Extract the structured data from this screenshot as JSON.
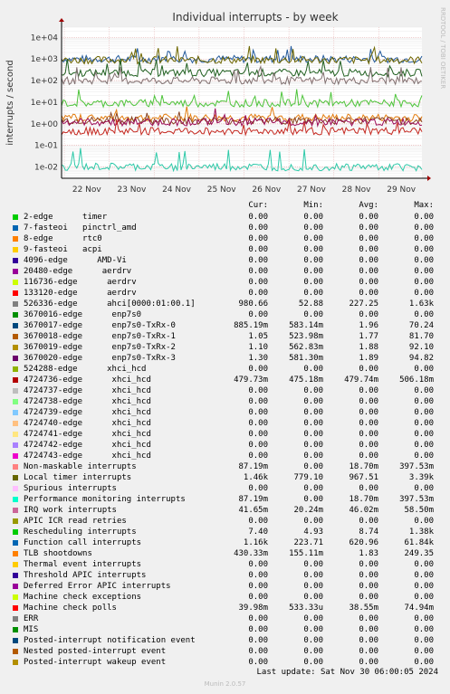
{
  "chart_data": {
    "type": "line",
    "title": "Individual interrupts - by week",
    "ylabel": "interrupts / second",
    "yscale": "log",
    "ylim": [
      0.003,
      30000
    ],
    "y_ticks": [
      {
        "value": 0.01,
        "label": "1e-02"
      },
      {
        "value": 0.1,
        "label": "1e-01"
      },
      {
        "value": 1,
        "label": "1e+00"
      },
      {
        "value": 10,
        "label": "1e+01"
      },
      {
        "value": 100,
        "label": "1e+02"
      },
      {
        "value": 1000,
        "label": "1e+03"
      },
      {
        "value": 10000,
        "label": "1e+04"
      }
    ],
    "x_ticks": [
      "22 Nov",
      "23 Nov",
      "24 Nov",
      "25 Nov",
      "26 Nov",
      "27 Nov",
      "28 Nov",
      "29 Nov"
    ],
    "watermark": "RRDTOOL / TOBI OETIKER",
    "grid": true,
    "series": [
      {
        "name": "Function call interrupts",
        "color": "#235A9C",
        "level": 1000
      },
      {
        "name": "Local timer interrupts",
        "color": "#6F6700",
        "level": 900
      },
      {
        "name": "526336-edge ahci[0000:01:00.1]",
        "color": "#206020",
        "level": 230
      },
      {
        "name": "Non-maskable interrupts",
        "color": "#807070",
        "level": 100
      },
      {
        "name": "Rescheduling interrupts",
        "color": "#4EC43B",
        "level": 9
      },
      {
        "name": "3670017-edge enp7s0-TxRx-0",
        "color": "#E37C0D",
        "level": 1.9
      },
      {
        "name": "3670019-edge enp7s0-TxRx-2",
        "color": "#884422",
        "level": 1.4
      },
      {
        "name": "Performance monitoring interrupts",
        "color": "#9A0C58",
        "level": 1.2
      },
      {
        "name": "4724736-edge xhci_hcd",
        "color": "#C52820",
        "level": 0.45
      },
      {
        "name": "TLB shootdowns",
        "color": "#2DC9A8",
        "level": 0.01
      }
    ]
  },
  "legend": {
    "headers": [
      "Cur:",
      "Min:",
      "Avg:",
      "Max:"
    ],
    "rows": [
      {
        "label": "2-edge      timer",
        "color": "#00CC00",
        "cur": "0.00",
        "min": "0.00",
        "avg": "0.00",
        "max": "0.00"
      },
      {
        "label": "7-fasteoi   pinctrl_amd",
        "color": "#0066B3",
        "cur": "0.00",
        "min": "0.00",
        "avg": "0.00",
        "max": "0.00"
      },
      {
        "label": "8-edge      rtc0",
        "color": "#FF8000",
        "cur": "0.00",
        "min": "0.00",
        "avg": "0.00",
        "max": "0.00"
      },
      {
        "label": "9-fasteoi   acpi",
        "color": "#FFCC00",
        "cur": "0.00",
        "min": "0.00",
        "avg": "0.00",
        "max": "0.00"
      },
      {
        "label": "4096-edge      AMD-Vi",
        "color": "#330099",
        "cur": "0.00",
        "min": "0.00",
        "avg": "0.00",
        "max": "0.00"
      },
      {
        "label": "20480-edge      aerdrv",
        "color": "#990099",
        "cur": "0.00",
        "min": "0.00",
        "avg": "0.00",
        "max": "0.00"
      },
      {
        "label": "116736-edge      aerdrv",
        "color": "#CCFF00",
        "cur": "0.00",
        "min": "0.00",
        "avg": "0.00",
        "max": "0.00"
      },
      {
        "label": "133120-edge      aerdrv",
        "color": "#FF0000",
        "cur": "0.00",
        "min": "0.00",
        "avg": "0.00",
        "max": "0.00"
      },
      {
        "label": "526336-edge      ahci[0000:01:00.1]",
        "color": "#808080",
        "cur": "980.66",
        "min": "52.88",
        "avg": "227.25",
        "max": "1.63k"
      },
      {
        "label": "3670016-edge      enp7s0",
        "color": "#008F00",
        "cur": "0.00",
        "min": "0.00",
        "avg": "0.00",
        "max": "0.00"
      },
      {
        "label": "3670017-edge      enp7s0-TxRx-0",
        "color": "#00487D",
        "cur": "885.19m",
        "min": "583.14m",
        "avg": "1.96",
        "max": "70.24"
      },
      {
        "label": "3670018-edge      enp7s0-TxRx-1",
        "color": "#B35A00",
        "cur": "1.05",
        "min": "523.98m",
        "avg": "1.77",
        "max": "81.70"
      },
      {
        "label": "3670019-edge      enp7s0-TxRx-2",
        "color": "#B38F00",
        "cur": "1.10",
        "min": "562.83m",
        "avg": "1.88",
        "max": "92.10"
      },
      {
        "label": "3670020-edge      enp7s0-TxRx-3",
        "color": "#6B006B",
        "cur": "1.30",
        "min": "581.30m",
        "avg": "1.89",
        "max": "94.82"
      },
      {
        "label": "524288-edge      xhci_hcd",
        "color": "#8FB300",
        "cur": "0.00",
        "min": "0.00",
        "avg": "0.00",
        "max": "0.00"
      },
      {
        "label": "4724736-edge      xhci_hcd",
        "color": "#B30000",
        "cur": "479.73m",
        "min": "475.18m",
        "avg": "479.74m",
        "max": "506.18m"
      },
      {
        "label": "4724737-edge      xhci_hcd",
        "color": "#BEBEBE",
        "cur": "0.00",
        "min": "0.00",
        "avg": "0.00",
        "max": "0.00"
      },
      {
        "label": "4724738-edge      xhci_hcd",
        "color": "#80FF80",
        "cur": "0.00",
        "min": "0.00",
        "avg": "0.00",
        "max": "0.00"
      },
      {
        "label": "4724739-edge      xhci_hcd",
        "color": "#80C9FF",
        "cur": "0.00",
        "min": "0.00",
        "avg": "0.00",
        "max": "0.00"
      },
      {
        "label": "4724740-edge      xhci_hcd",
        "color": "#FFC080",
        "cur": "0.00",
        "min": "0.00",
        "avg": "0.00",
        "max": "0.00"
      },
      {
        "label": "4724741-edge      xhci_hcd",
        "color": "#FFE680",
        "cur": "0.00",
        "min": "0.00",
        "avg": "0.00",
        "max": "0.00"
      },
      {
        "label": "4724742-edge      xhci_hcd",
        "color": "#AA80FF",
        "cur": "0.00",
        "min": "0.00",
        "avg": "0.00",
        "max": "0.00"
      },
      {
        "label": "4724743-edge      xhci_hcd",
        "color": "#EE00CC",
        "cur": "0.00",
        "min": "0.00",
        "avg": "0.00",
        "max": "0.00"
      },
      {
        "label": "Non-maskable interrupts",
        "color": "#FF8080",
        "cur": "87.19m",
        "min": "0.00",
        "avg": "18.70m",
        "max": "397.53m"
      },
      {
        "label": "Local timer interrupts",
        "color": "#666600",
        "cur": "1.46k",
        "min": "779.10",
        "avg": "967.51",
        "max": "3.39k"
      },
      {
        "label": "Spurious interrupts",
        "color": "#FFBFFF",
        "cur": "0.00",
        "min": "0.00",
        "avg": "0.00",
        "max": "0.00"
      },
      {
        "label": "Performance monitoring interrupts",
        "color": "#00FFCC",
        "cur": "87.19m",
        "min": "0.00",
        "avg": "18.70m",
        "max": "397.53m"
      },
      {
        "label": "IRQ work interrupts",
        "color": "#CC6699",
        "cur": "41.65m",
        "min": "20.24m",
        "avg": "46.02m",
        "max": "58.50m"
      },
      {
        "label": "APIC ICR read retries",
        "color": "#999900",
        "cur": "0.00",
        "min": "0.00",
        "avg": "0.00",
        "max": "0.00"
      },
      {
        "label": "Rescheduling interrupts",
        "color": "#00CC00",
        "cur": "7.40",
        "min": "4.93",
        "avg": "8.74",
        "max": "1.38k"
      },
      {
        "label": "Function call interrupts",
        "color": "#0066B3",
        "cur": "1.16k",
        "min": "223.71",
        "avg": "620.96",
        "max": "61.84k"
      },
      {
        "label": "TLB shootdowns",
        "color": "#FF8000",
        "cur": "430.33m",
        "min": "155.11m",
        "avg": "1.83",
        "max": "249.35"
      },
      {
        "label": "Thermal event interrupts",
        "color": "#FFCC00",
        "cur": "0.00",
        "min": "0.00",
        "avg": "0.00",
        "max": "0.00"
      },
      {
        "label": "Threshold APIC interrupts",
        "color": "#330099",
        "cur": "0.00",
        "min": "0.00",
        "avg": "0.00",
        "max": "0.00"
      },
      {
        "label": "Deferred Error APIC interrupts",
        "color": "#990099",
        "cur": "0.00",
        "min": "0.00",
        "avg": "0.00",
        "max": "0.00"
      },
      {
        "label": "Machine check exceptions",
        "color": "#CCFF00",
        "cur": "0.00",
        "min": "0.00",
        "avg": "0.00",
        "max": "0.00"
      },
      {
        "label": "Machine check polls",
        "color": "#FF0000",
        "cur": "39.98m",
        "min": "533.33u",
        "avg": "38.55m",
        "max": "74.94m"
      },
      {
        "label": "ERR",
        "color": "#808080",
        "cur": "0.00",
        "min": "0.00",
        "avg": "0.00",
        "max": "0.00"
      },
      {
        "label": "MIS",
        "color": "#008F00",
        "cur": "0.00",
        "min": "0.00",
        "avg": "0.00",
        "max": "0.00"
      },
      {
        "label": "Posted-interrupt notification event",
        "color": "#00487D",
        "cur": "0.00",
        "min": "0.00",
        "avg": "0.00",
        "max": "0.00"
      },
      {
        "label": "Nested posted-interrupt event",
        "color": "#B35A00",
        "cur": "0.00",
        "min": "0.00",
        "avg": "0.00",
        "max": "0.00"
      },
      {
        "label": "Posted-interrupt wakeup event",
        "color": "#B38F00",
        "cur": "0.00",
        "min": "0.00",
        "avg": "0.00",
        "max": "0.00"
      }
    ]
  },
  "footer": {
    "last_update": "Last update: Sat Nov 30 06:00:05 2024",
    "version": "Munin 2.0.57"
  }
}
